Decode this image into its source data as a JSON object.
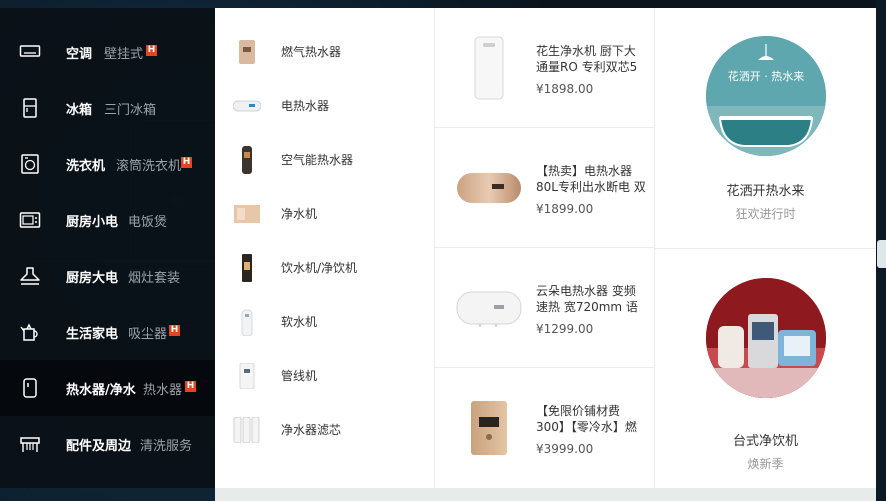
{
  "categories": [
    {
      "icon": "air-conditioner-icon",
      "name": "空调",
      "sub": "壁挂式",
      "hot": true
    },
    {
      "icon": "fridge-icon",
      "name": "冰箱",
      "sub": "三门冰箱",
      "hot": false
    },
    {
      "icon": "washing-machine-icon",
      "name": "洗衣机",
      "sub": "滚筒洗衣机",
      "hot": true
    },
    {
      "icon": "microwave-icon",
      "name": "厨房小电",
      "sub": "电饭煲",
      "hot": false
    },
    {
      "icon": "range-hood-icon",
      "name": "厨房大电",
      "sub": "烟灶套装",
      "hot": false
    },
    {
      "icon": "kettle-icon",
      "name": "生活家电",
      "sub": "吸尘器",
      "hot": true
    },
    {
      "icon": "water-heater-icon",
      "name": "热水器/净水",
      "sub": "热水器",
      "hot": true
    },
    {
      "icon": "accessories-icon",
      "name": "配件及周边",
      "sub": "清洗服务",
      "hot": false
    }
  ],
  "hot_badge": "H",
  "subcategories": [
    {
      "label": "燃气热水器",
      "thumb": "gas-water-heater-thumb"
    },
    {
      "label": "电热水器",
      "thumb": "electric-water-heater-thumb"
    },
    {
      "label": "空气能热水器",
      "thumb": "heat-pump-heater-thumb"
    },
    {
      "label": "净水机",
      "thumb": "water-purifier-thumb"
    },
    {
      "label": "饮水机/净饮机",
      "thumb": "water-dispenser-thumb"
    },
    {
      "label": "软水机",
      "thumb": "water-softener-thumb"
    },
    {
      "label": "管线机",
      "thumb": "pipeline-machine-thumb"
    },
    {
      "label": "净水器滤芯",
      "thumb": "filter-cartridge-thumb"
    }
  ],
  "products": [
    {
      "title": "花生净水机 厨下大通量RO 专利双芯5",
      "price": "¥1898.00",
      "image": "purifier-product-image"
    },
    {
      "title": "【热卖】电热水器80L专利出水断电 双",
      "price": "¥1899.00",
      "image": "gold-heater-product-image"
    },
    {
      "title": "云朵电热水器 变频速热 宽720mm 语音",
      "price": "¥1299.00",
      "image": "white-heater-product-image"
    },
    {
      "title": "【免限价铺材费300】【零冷水】燃",
      "price": "¥3999.00",
      "image": "gas-heater-product-image"
    }
  ],
  "promos": [
    {
      "title": "花洒开热水来",
      "sub": "狂欢进行时",
      "banner": "花洒开 · 热水来",
      "image": "bathtub-promo-image"
    },
    {
      "title": "台式净饮机",
      "sub": "焕新季",
      "image": "desktop-purifier-promo-image"
    }
  ],
  "colors": {
    "menu_bg": "#0a1016",
    "active_bg": "#05080c",
    "badge": "#e8431e",
    "panel_bg": "#ffffff"
  }
}
